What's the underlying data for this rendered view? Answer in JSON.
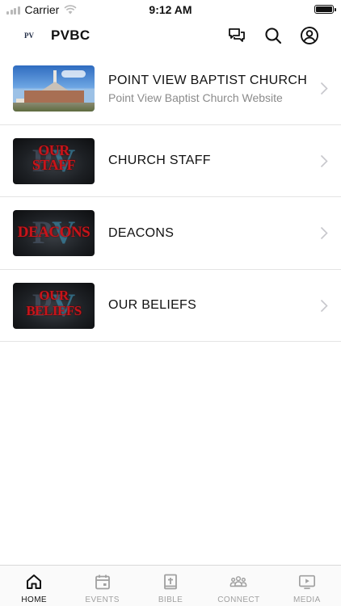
{
  "status_bar": {
    "carrier": "Carrier",
    "time": "9:12 AM"
  },
  "header": {
    "logo_text": "PV",
    "title": "PVBC",
    "actions": [
      "chat-icon",
      "search-icon",
      "account-icon"
    ]
  },
  "menu_items": [
    {
      "title": "POINT VIEW BAPTIST CHURCH",
      "subtitle": "Point View Baptist Church Website",
      "thumbnail": "church-building-photo"
    },
    {
      "title": "CHURCH STAFF",
      "subtitle": "",
      "thumbnail": "church-staff-graphic",
      "thumbnail_lines": [
        "OUR",
        "STAFF"
      ]
    },
    {
      "title": "DEACONS",
      "subtitle": "",
      "thumbnail": "deacons-graphic",
      "thumbnail_lines": [
        "DEACONS"
      ]
    },
    {
      "title": "OUR BELIEFS",
      "subtitle": "",
      "thumbnail": "our-beliefs-graphic",
      "thumbnail_lines": [
        "OUR",
        "BELIEFS"
      ]
    }
  ],
  "tab_bar": [
    {
      "label": "HOME",
      "icon": "home-icon",
      "active": true
    },
    {
      "label": "EVENTS",
      "icon": "calendar-icon",
      "active": false
    },
    {
      "label": "BIBLE",
      "icon": "bible-icon",
      "active": false
    },
    {
      "label": "CONNECT",
      "icon": "people-icon",
      "active": false
    },
    {
      "label": "MEDIA",
      "icon": "play-icon",
      "active": false
    }
  ],
  "colors": {
    "active": "#111111",
    "inactive": "#a0a0a0",
    "thumbnail_text": "#c8141a",
    "divider": "#e4e4e4"
  }
}
